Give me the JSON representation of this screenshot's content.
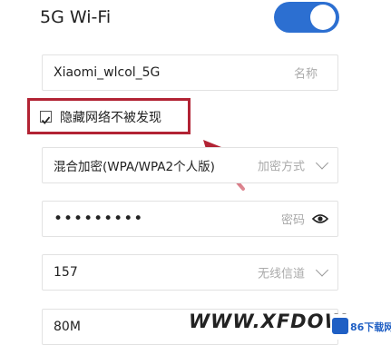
{
  "header": {
    "title": "5G Wi-Fi",
    "toggle_on": true
  },
  "fields": {
    "name": {
      "value": "Xiaomi_wlcol_5G",
      "label": "名称"
    },
    "encryption": {
      "value": "混合加密(WPA/WPA2个人版)",
      "label": "加密方式"
    },
    "password": {
      "value": "•••••••••",
      "label": "密码"
    },
    "channel": {
      "value": "157",
      "label": "无线信道"
    },
    "bandwidth": {
      "value": "80M"
    }
  },
  "hidden_network": {
    "label": "隐藏网络不被发现",
    "checked": true
  },
  "watermark": {
    "text": "WWW.XFDOW",
    "logo": "86下载网"
  },
  "colors": {
    "accent": "#2c6fd1",
    "highlight": "#b22334"
  }
}
